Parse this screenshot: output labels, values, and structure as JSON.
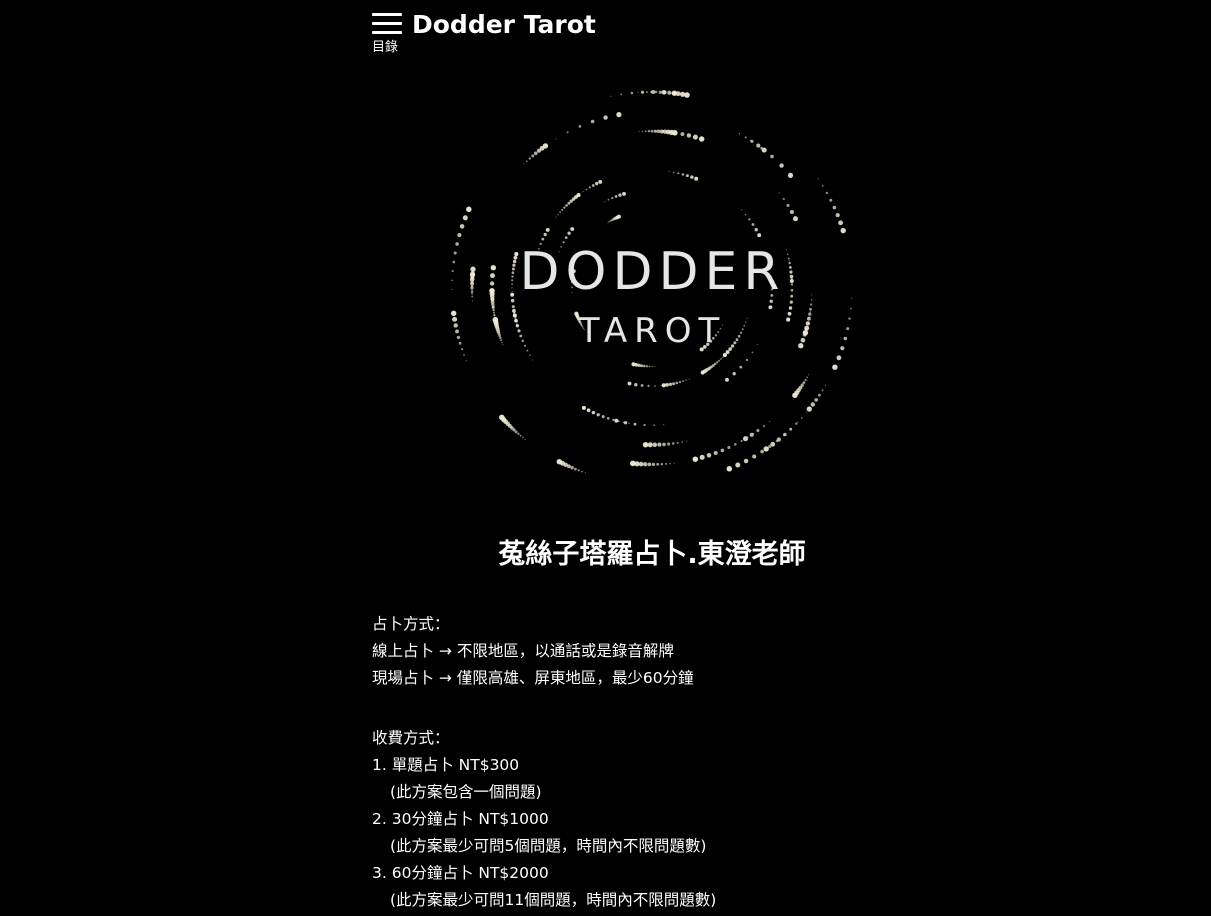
{
  "header": {
    "menu_label": "目錄",
    "site_title": "Dodder Tarot"
  },
  "logo": {
    "main_text": "DODDER",
    "sub_text": "TAROT"
  },
  "main": {
    "heading": "菟絲子塔羅占卜.東澄老師",
    "method_section": {
      "title": "占卜方式：",
      "lines": [
        "線上占卜 → 不限地區，以通話或是錄音解牌",
        "現場占卜 → 僅限高雄、屏東地區，最少60分鐘"
      ]
    },
    "fee_section": {
      "title": "收費方式：",
      "items": [
        {
          "label": "1. 單題占卜 NT$300",
          "note": "(此方案包含一個問題)"
        },
        {
          "label": "2. 30分鐘占卜 NT$1000",
          "note": "(此方案最少可問5個問題，時間內不限問題數)"
        },
        {
          "label": "3. 60分鐘占卜 NT$2000",
          "note": "(此方案最少可問11個問題，時間內不限問題數)"
        }
      ]
    }
  },
  "colors": {
    "background": "#000000",
    "text": "#ffffff",
    "logo_text": "#e6e6e6",
    "logo_dots": "#f3ecd8"
  }
}
